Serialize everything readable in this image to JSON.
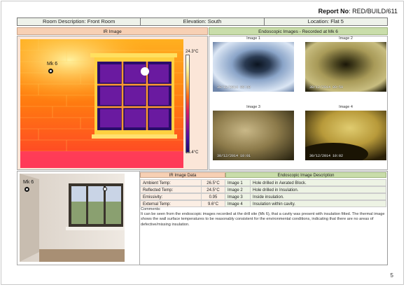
{
  "report": {
    "prefix": "Report No",
    "number": ": RED/BUILD/611"
  },
  "header": {
    "room": "Room Description: Front Room",
    "elevation": "Elevation: South",
    "location": "Location: Flat 5"
  },
  "ir_section": {
    "title": "IR Image",
    "marker": "Mk 6",
    "scale_max": "24.3°C",
    "scale_min": "18.4°C"
  },
  "photo": {
    "marker": "Mk 6"
  },
  "endo_section": {
    "title": "Endoscopic Images - Recorded at Mk 6",
    "images": [
      {
        "caption": "Image 1",
        "stamp": "30/12/2014 09:58"
      },
      {
        "caption": "Image 2",
        "stamp": "30/12/2014 09:59"
      },
      {
        "caption": "Image 3",
        "stamp": "30/12/2014 10:01"
      },
      {
        "caption": "Image 4",
        "stamp": "30/12/2014 10:02"
      }
    ]
  },
  "ir_data": {
    "title": "IR Image Data",
    "rows": [
      {
        "label": "Ambient Temp:",
        "value": "26.5°C"
      },
      {
        "label": "Reflected Temp:",
        "value": "24.5°C"
      },
      {
        "label": "Emissivity:",
        "value": "0.95"
      },
      {
        "label": "External Temp:",
        "value": "9.6°C"
      }
    ]
  },
  "endo_desc": {
    "title": "Endoscopic Image Description",
    "rows": [
      {
        "image": "Image 1",
        "text": "Hole drilled in Aerated Block."
      },
      {
        "image": "Image 2",
        "text": "Hole drilled in Insulation."
      },
      {
        "image": "Image 3",
        "text": "Inside insulation."
      },
      {
        "image": "Image 4",
        "text": "Insulation within cavity."
      }
    ]
  },
  "comments": {
    "label": "Comments:",
    "text": "It can be seen from the endoscopic images recorded at the drill site (Mk 6), that a cavity was present with insulation fitted. The thermal image shows the wall surface temperatures to be reasonably consistent for the environmental conditions, indicating that there are no areas of defective/missing insulation."
  },
  "page_number": "5",
  "colors": {
    "ir_header": "#f7d0b4",
    "endo_header": "#c9ddaa"
  }
}
